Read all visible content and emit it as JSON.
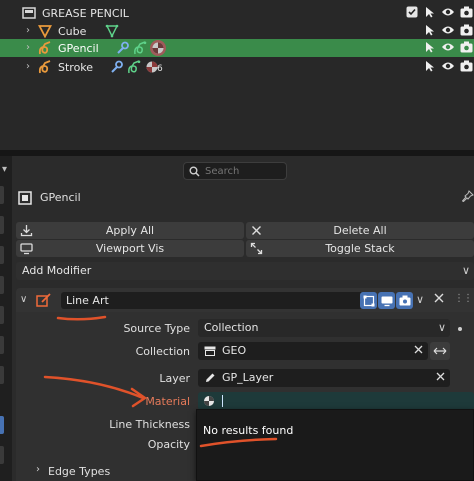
{
  "outliner": {
    "rows": [
      {
        "label": "GREASE PENCIL",
        "icon": "grease-pencil-data-icon"
      },
      {
        "label": "Cube",
        "icon": "cone-object-icon"
      },
      {
        "label": "GPencil",
        "icon": "gpencil-object-icon",
        "selected": true
      },
      {
        "label": "Stroke",
        "icon": "gpencil-object-icon",
        "badge": "6"
      }
    ]
  },
  "properties": {
    "search": {
      "placeholder": "Search"
    },
    "object_name": "GPencil",
    "buttons": {
      "apply_all": "Apply All",
      "delete_all": "Delete All",
      "viewport_vis": "Viewport Vis",
      "toggle_stack": "Toggle Stack"
    },
    "add_modifier": "Add Modifier",
    "modifier": {
      "name": "Line Art",
      "fields": {
        "source_type": {
          "label": "Source Type",
          "value": "Collection"
        },
        "collection": {
          "label": "Collection",
          "value": "GEO"
        },
        "layer": {
          "label": "Layer",
          "value": "GP_Layer"
        },
        "material": {
          "label": "Material",
          "value": ""
        },
        "line_thickness": {
          "label": "Line Thickness"
        },
        "opacity": {
          "label": "Opacity"
        }
      },
      "subpanel": "Edge Types"
    },
    "popup": {
      "message": "No results found"
    }
  },
  "colors": {
    "selection": "#3a8b4a",
    "annotation": "#e0522a",
    "material_field": "#1e3a3a",
    "accent": "#4772b3"
  }
}
